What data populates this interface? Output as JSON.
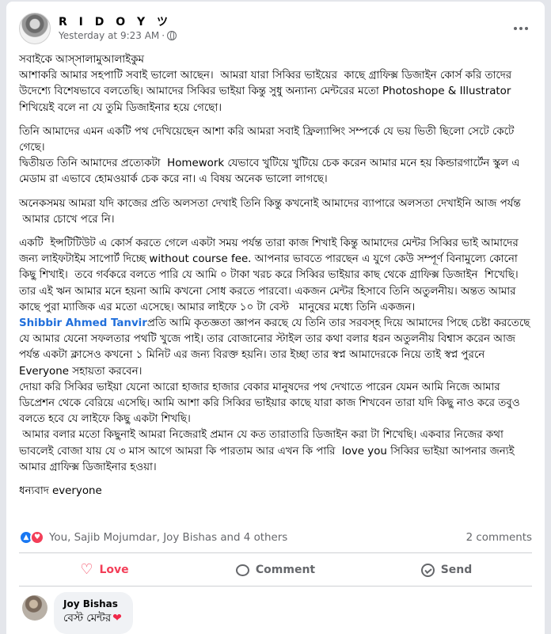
{
  "post": {
    "author": "R I D O Y ツ",
    "timestamp": "Yesterday at 9:23 AM",
    "separator": "·",
    "privacy_icon": "globe-icon",
    "paragraphs": [
      "সবাইকে আস্সালামুআলাইকুম\nআশাকরি আমার সহপাটি সবাই ভালো আছেন।  আমরা যারা সিব্বির ভাইয়ের  কাছে গ্রাফিক্স ডিজাইন কোর্স করি তাদের উদেশ্যে বিশেষভাবে বলতেছি। আমাদের সিব্বির ভাইয়া কিন্তু সুধু অন্যান্য মেন্টরের মতো Photoshope & Illustrator শিখিয়েই বলে না যে তুমি ডিজাইনার হয়ে গেছো।",
      "তিনি আমাদের এমন একটি পথ দেখিয়েছেন আশা করি আমরা সবাই ফ্রিল্যান্সিং সম্পর্কে যে ভয় ভিতী ছিলো সেটে কেটে গেছে।\nদ্বিতীয়ত তিনি আমাদের প্রত্যেকটা  Homework যেভাবে খুটিয়ে খুটিয়ে চেক করেন আমার মনে হয় কিন্ডারগার্টেন স্কুল এ মেডাম রা এভাবে হোমওয়ার্ক চেক করে না। এ বিষয় অনেক ভালো লাগছে।",
      "অনেকসময় আমরা যদি কাজের প্রতি অলসতা দেখাই তিনি কিন্তু কখনোই আমাদের ব্যাপারে অলসতা দেখাইনি আজ পর্যন্ত\n আমার চোখে পরে নি।",
      "একটি  ইন্সটিটিউট এ কোর্স করতে গেলে একটা সময় পর্যন্ত তারা কাজ শিখাই কিন্তু আমাদের মেন্টর সিব্বির ভাই আমাদের জন্য লাইফটাইম সাপোর্ট দিচ্ছে without course fee. আপনার ভাবতে পারছেন এ যুগে কেউ সম্পূর্ণ বিনামুল্যে কোনো কিছু শিখাই।  তবে গর্বকরে বলতে পারি যে আমি ০ টাকা খরচ করে সিব্বির ভাইয়ার কাছ থেকে গ্রাফিক্স ডিজাইন  শিখেছি। তার এই ঋন আমার মনে হয়না আমি কখনো সোধ করতে পারবো। একজন মেন্টর হিসাবে তিনি অতুলনীয়। অন্তত আমার কাছে পুরা ম্যাজিক এর মতো এসেছে। আমার লাইফে ১০ টা বেস্ট   মানুষের মধ্যে তিনি একজন।"
    ],
    "mention": "Shibbir Ahmed Tanvir",
    "after_mention": "প্রতি আমি কৃতজ্ঞতা জ্ঞাপন করছে যে তিনি তার সরবস্হ দিয়ে আমাদের পিছে চেষ্টা করতেছে যে আমার যেনো সফলতার পথটি খুজে পাই। তার বোজানোর স্টাইল তার কথা বলার ধরন অতুলনীয় বিশ্বাস করেন আজ পর্যন্ত একটা ক্লাসেও কখনো ১ মিনিট এর জন্য বিরক্ত হয়নি। তার ইচ্ছা তার স্বপ্ন আমাদেরকে নিয়ে তাই স্বপ্ন পুরনে Everyone সহায়তা করবেন।\nদোয়া করি সিব্বির ভাইয়া যেনো আরো হাজার হাজার বেকার মানুষদের পথ দেখাতে পারেন যেমন আমি নিজে আমার ডিপ্রেশন থেকে বেরিয়ে এসেছি। আমি আশা করি সিব্বির ভাইয়ার কাছে যারা কাজ শিখবেন তারা যদি কিছু নাও করে তবুও বলতে হবে যে লাইফে কিছু একটা শিখছি।\n আমার বলার মতো কিছুনাই আমরা নিজেরাই প্রমান যে কত তারাতারি ডিজাইন করা টা শিখেছি। একবার নিজের কথা ভাবলেই বোজা যায় যে ৩ মাস আগে আমরা কি পারতাম আর এখন কি পারি  love you সিব্বির ভাইয়া আপনার জন্যই আমার গ্রাফিক্স ডিজাইনার হওয়া।",
    "closing": "ধন্যবাদ everyone"
  },
  "reactions": {
    "icons": [
      "like-icon",
      "love-icon"
    ],
    "reactors": "You, Sajib Mojumdar, Joy Bishas and 4 others",
    "comments_count": "2 comments"
  },
  "actions": {
    "love_label": "Love",
    "comment_label": "Comment",
    "send_label": "Send"
  },
  "comment": {
    "author": "Joy Bishas",
    "text": "বেস্ট মেন্টর",
    "emoji": "❤"
  },
  "colors": {
    "love": "#f33e58",
    "mention": "#216fdb",
    "muted": "#65676b"
  }
}
